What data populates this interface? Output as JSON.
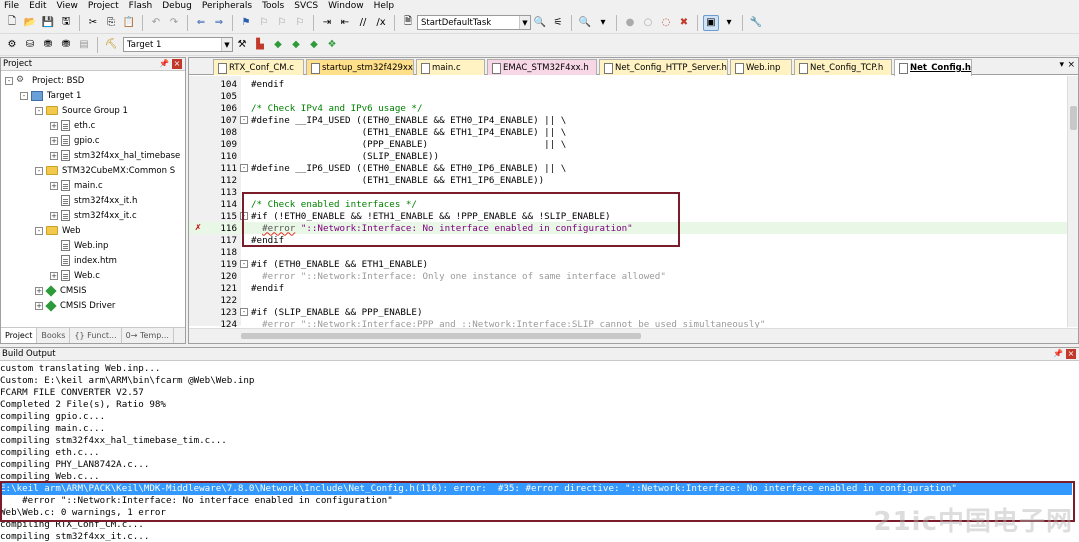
{
  "menu": [
    "File",
    "Edit",
    "View",
    "Project",
    "Flash",
    "Debug",
    "Peripherals",
    "Tools",
    "SVCS",
    "Window",
    "Help"
  ],
  "toolbar": {
    "task_combo": "StartDefaultTask",
    "target_combo": "Target 1"
  },
  "project_panel": {
    "title": "Project",
    "tree": [
      {
        "label": "Project: BSD",
        "indent": 0,
        "icon": "project",
        "exp": "-"
      },
      {
        "label": "Target 1",
        "indent": 1,
        "icon": "target",
        "exp": "-"
      },
      {
        "label": "Source Group 1",
        "indent": 2,
        "icon": "folder",
        "exp": "-"
      },
      {
        "label": "eth.c",
        "indent": 3,
        "icon": "file",
        "exp": "+"
      },
      {
        "label": "gpio.c",
        "indent": 3,
        "icon": "file",
        "exp": "+"
      },
      {
        "label": "stm32f4xx_hal_timebase",
        "indent": 3,
        "icon": "file",
        "exp": "+"
      },
      {
        "label": "STM32CubeMX:Common S",
        "indent": 2,
        "icon": "folder",
        "exp": "-"
      },
      {
        "label": "main.c",
        "indent": 3,
        "icon": "file",
        "exp": "+"
      },
      {
        "label": "stm32f4xx_it.h",
        "indent": 3,
        "icon": "file",
        "exp": ""
      },
      {
        "label": "stm32f4xx_it.c",
        "indent": 3,
        "icon": "file",
        "exp": "+"
      },
      {
        "label": "Web",
        "indent": 2,
        "icon": "folder",
        "exp": "-"
      },
      {
        "label": "Web.inp",
        "indent": 3,
        "icon": "file",
        "exp": ""
      },
      {
        "label": "index.htm",
        "indent": 3,
        "icon": "file",
        "exp": ""
      },
      {
        "label": "Web.c",
        "indent": 3,
        "icon": "file",
        "exp": "+"
      },
      {
        "label": "CMSIS",
        "indent": 2,
        "icon": "gem",
        "exp": "+"
      },
      {
        "label": "CMSIS Driver",
        "indent": 2,
        "icon": "gem",
        "exp": "+"
      }
    ],
    "tabs": [
      "Project",
      "Books",
      "{} Funct...",
      "0→ Temp..."
    ]
  },
  "editor": {
    "tabs": [
      "RTX_Conf_CM.c",
      "startup_stm32f429xx.s",
      "main.c",
      "EMAC_STM32F4xx.h",
      "Net_Config_HTTP_Server.h",
      "Web.inp",
      "Net_Config_TCP.h",
      "Net_Config.h"
    ],
    "active_tab": "Net_Config.h",
    "lines": [
      {
        "n": "104",
        "fold": "",
        "text": "#endif",
        "cls": "c-pre"
      },
      {
        "n": "105",
        "fold": "",
        "text": "",
        "cls": ""
      },
      {
        "n": "106",
        "fold": "",
        "text": "/* Check IPv4 and IPv6 usage */",
        "cls": "c-comment"
      },
      {
        "n": "107",
        "fold": "-",
        "text": "#define __IP4_USED ((ETH0_ENABLE && ETH0_IP4_ENABLE) || \\",
        "cls": "c-pre"
      },
      {
        "n": "108",
        "fold": "",
        "text": "                    (ETH1_ENABLE && ETH1_IP4_ENABLE) || \\",
        "cls": "c-pre"
      },
      {
        "n": "109",
        "fold": "",
        "text": "                    (PPP_ENABLE)                     || \\",
        "cls": "c-pre"
      },
      {
        "n": "110",
        "fold": "",
        "text": "                    (SLIP_ENABLE))",
        "cls": "c-pre"
      },
      {
        "n": "111",
        "fold": "-",
        "text": "#define __IP6_USED ((ETH0_ENABLE && ETH0_IP6_ENABLE) || \\",
        "cls": "c-pre"
      },
      {
        "n": "112",
        "fold": "",
        "text": "                    (ETH1_ENABLE && ETH1_IP6_ENABLE))",
        "cls": "c-pre"
      },
      {
        "n": "113",
        "fold": "",
        "text": "",
        "cls": ""
      },
      {
        "n": "114",
        "fold": "",
        "text": "/* Check enabled interfaces */",
        "cls": "c-comment"
      },
      {
        "n": "115",
        "fold": "-",
        "text": "#if (!ETH0_ENABLE && !ETH1_ENABLE && !PPP_ENABLE && !SLIP_ENABLE)",
        "cls": "c-pre"
      },
      {
        "n": "116",
        "fold": "",
        "text": "  #error \"::Network:Interface: No interface enabled in configuration\"",
        "cls": "err-line"
      },
      {
        "n": "117",
        "fold": "",
        "text": "#endif",
        "cls": "c-pre"
      },
      {
        "n": "118",
        "fold": "",
        "text": "",
        "cls": ""
      },
      {
        "n": "119",
        "fold": "-",
        "text": "#if (ETH0_ENABLE && ETH1_ENABLE)",
        "cls": "c-pre"
      },
      {
        "n": "120",
        "fold": "",
        "text": "  #error \"::Network:Interface: Only one instance of same interface allowed\"",
        "cls": "c-dim"
      },
      {
        "n": "121",
        "fold": "",
        "text": "#endif",
        "cls": "c-pre"
      },
      {
        "n": "122",
        "fold": "",
        "text": "",
        "cls": ""
      },
      {
        "n": "123",
        "fold": "-",
        "text": "#if (SLIP_ENABLE && PPP_ENABLE)",
        "cls": "c-pre"
      },
      {
        "n": "124",
        "fold": "",
        "text": "  #error \"::Network:Interface:PPP and ::Network:Interface:SLIP cannot be used simultaneously\"",
        "cls": "c-dim"
      }
    ]
  },
  "build_output": {
    "title": "Build Output",
    "lines": [
      "custom translating Web.inp...",
      "Custom: E:\\keil arm\\ARM\\bin\\fcarm @Web\\Web.inp",
      "FCARM FILE CONVERTER V2.57",
      "Completed 2 File(s), Ratio 98%",
      "compiling gpio.c...",
      "compiling main.c...",
      "compiling stm32f4xx_hal_timebase_tim.c...",
      "compiling eth.c...",
      "compiling PHY_LAN8742A.c...",
      "compiling Web.c...",
      "E:\\keil arm\\ARM\\PACK\\Keil\\MDK-Middleware\\7.8.0\\Network\\Include\\Net_Config.h(116): error:  #35: #error directive: \"::Network:Interface: No interface enabled in configuration\"",
      "    #error \"::Network:Interface: No interface enabled in configuration\"",
      "Web\\Web.c: 0 warnings, 1 error",
      "compiling RTX_Conf_CM.c...",
      "compiling stm32f4xx_it.c..."
    ],
    "selected_index": 10
  },
  "watermark": "21ic中国电子网"
}
